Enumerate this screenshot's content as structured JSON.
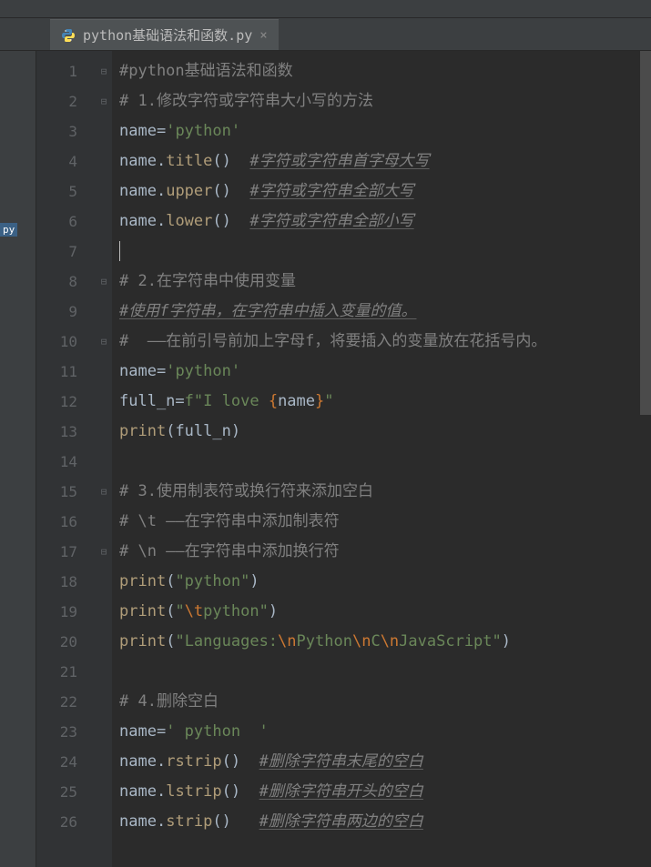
{
  "tab": {
    "filename": "python基础语法和函数.py"
  },
  "badge": "py",
  "lines": {
    "n1": "1",
    "n2": "2",
    "n3": "3",
    "n4": "4",
    "n5": "5",
    "n6": "6",
    "n7": "7",
    "n8": "8",
    "n9": "9",
    "n10": "10",
    "n11": "11",
    "n12": "12",
    "n13": "13",
    "n14": "14",
    "n15": "15",
    "n16": "16",
    "n17": "17",
    "n18": "18",
    "n19": "19",
    "n20": "20",
    "n21": "21",
    "n22": "22",
    "n23": "23",
    "n24": "24",
    "n25": "25",
    "n26": "26"
  },
  "code": {
    "l1_c1": "#python基础语法和函数",
    "l2_c1": "# 1.修改字符或字符串大小写的方法",
    "l3_v": "name",
    "l3_op": "=",
    "l3_s": "'python'",
    "l4_v": "name",
    "l4_dot": ".",
    "l4_fn": "title",
    "l4_p": "()",
    "l4_sp": "  ",
    "l4_c": "#字符或字符串首字母大写",
    "l5_v": "name",
    "l5_dot": ".",
    "l5_fn": "upper",
    "l5_p": "()",
    "l5_sp": "  ",
    "l5_c": "#字符或字符串全部大写",
    "l6_v": "name",
    "l6_dot": ".",
    "l6_fn": "lower",
    "l6_p": "()",
    "l6_sp": "  ",
    "l6_c": "#字符或字符串全部小写",
    "l8_c": "# 2.在字符串中使用变量",
    "l9_c": "#使用f字符串，在字符串中插入变量的值。",
    "l10_c": "#  ——在前引号前加上字母f，将要插入的变量放在花括号内。",
    "l11_v": "name",
    "l11_op": "=",
    "l11_s": "'python'",
    "l12_v": "full_n",
    "l12_op": "=",
    "l12_f": "f",
    "l12_s1": "\"I love ",
    "l12_b1": "{",
    "l12_vn": "name",
    "l12_b2": "}",
    "l12_s2": "\"",
    "l13_fn": "print",
    "l13_p1": "(",
    "l13_v": "full_n",
    "l13_p2": ")",
    "l15_c": "# 3.使用制表符或换行符来添加空白",
    "l16_c": "# \\t ——在字符串中添加制表符",
    "l17_c": "# \\n ——在字符串中添加换行符",
    "l18_fn": "print",
    "l18_p1": "(",
    "l18_s": "\"python\"",
    "l18_p2": ")",
    "l19_fn": "print",
    "l19_p1": "(",
    "l19_q1": "\"",
    "l19_e": "\\t",
    "l19_s": "python",
    "l19_q2": "\"",
    "l19_p2": ")",
    "l20_fn": "print",
    "l20_p1": "(",
    "l20_q1": "\"",
    "l20_s1": "Languages:",
    "l20_e1": "\\n",
    "l20_s2": "Python",
    "l20_e2": "\\n",
    "l20_s3": "C",
    "l20_e3": "\\n",
    "l20_s4": "JavaScript",
    "l20_q2": "\"",
    "l20_p2": ")",
    "l22_c": "# 4.删除空白",
    "l23_v": "name",
    "l23_op": "=",
    "l23_s": "' python  '",
    "l24_v": "name",
    "l24_dot": ".",
    "l24_fn": "rstrip",
    "l24_p": "()",
    "l24_sp": "  ",
    "l24_c": "#删除字符串末尾的空白",
    "l25_v": "name",
    "l25_dot": ".",
    "l25_fn": "lstrip",
    "l25_p": "()",
    "l25_sp": "  ",
    "l25_c": "#删除字符串开头的空白",
    "l26_v": "name",
    "l26_dot": ".",
    "l26_fn": "strip",
    "l26_p": "()",
    "l26_sp": "   ",
    "l26_c": "#删除字符串两边的空白"
  }
}
